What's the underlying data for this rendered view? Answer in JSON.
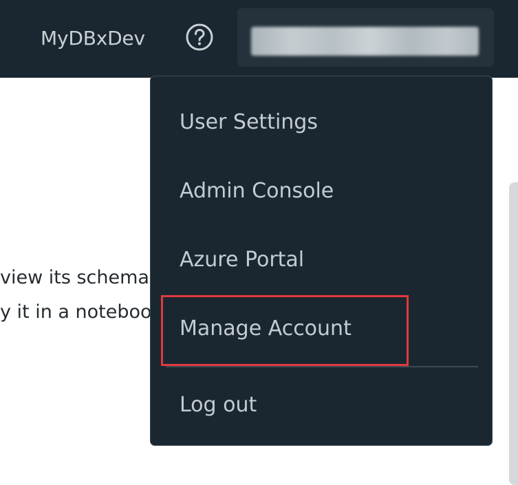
{
  "header": {
    "workspace_name": "MyDBxDev",
    "help_icon": "question-circle-icon",
    "user_name_redacted": true
  },
  "content": {
    "line1": "view its schema",
    "line2": "y it in a notebook"
  },
  "user_menu": {
    "items": [
      {
        "label": "User Settings"
      },
      {
        "label": "Admin Console"
      },
      {
        "label": "Azure Portal"
      },
      {
        "label": "Manage Account",
        "highlighted": true
      },
      {
        "label": "Log out"
      }
    ]
  },
  "colors": {
    "topbar_bg": "#1b2730",
    "menu_bg": "#1b2730",
    "menu_text": "#c3ccd2",
    "highlight": "#e0393e"
  }
}
